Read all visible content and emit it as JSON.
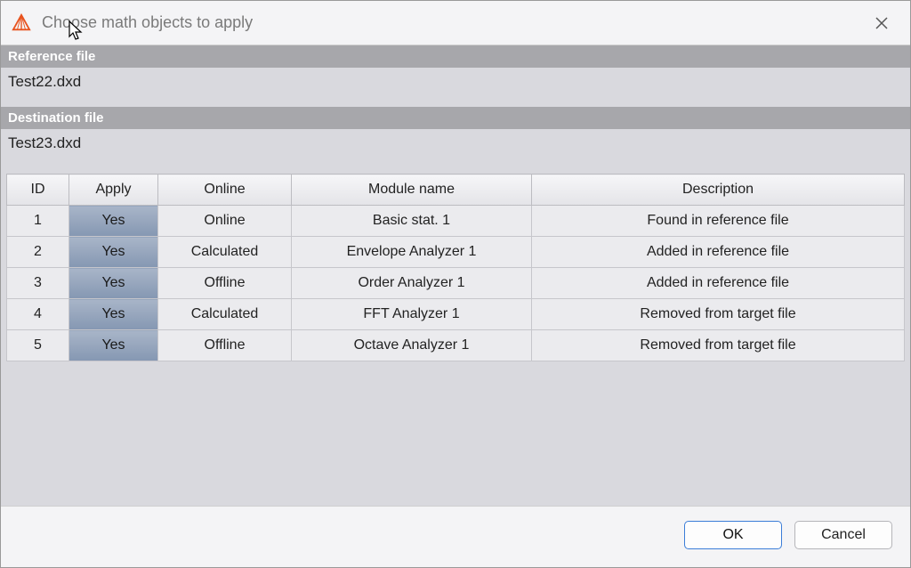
{
  "title": "Choose math objects to apply",
  "sections": {
    "reference_label": "Reference file",
    "reference_value": "Test22.dxd",
    "destination_label": "Destination file",
    "destination_value": "Test23.dxd"
  },
  "table": {
    "headers": {
      "id": "ID",
      "apply": "Apply",
      "online": "Online",
      "module": "Module name",
      "description": "Description"
    },
    "rows": [
      {
        "id": "1",
        "apply": "Yes",
        "online": "Online",
        "module": "Basic stat. 1",
        "description": "Found in reference file"
      },
      {
        "id": "2",
        "apply": "Yes",
        "online": "Calculated",
        "module": "Envelope Analyzer 1",
        "description": "Added in reference file"
      },
      {
        "id": "3",
        "apply": "Yes",
        "online": "Offline",
        "module": "Order Analyzer 1",
        "description": "Added in reference file"
      },
      {
        "id": "4",
        "apply": "Yes",
        "online": "Calculated",
        "module": "FFT Analyzer 1",
        "description": "Removed from target file"
      },
      {
        "id": "5",
        "apply": "Yes",
        "online": "Offline",
        "module": "Octave Analyzer 1",
        "description": "Removed from target file"
      }
    ]
  },
  "buttons": {
    "ok": "OK",
    "cancel": "Cancel"
  }
}
